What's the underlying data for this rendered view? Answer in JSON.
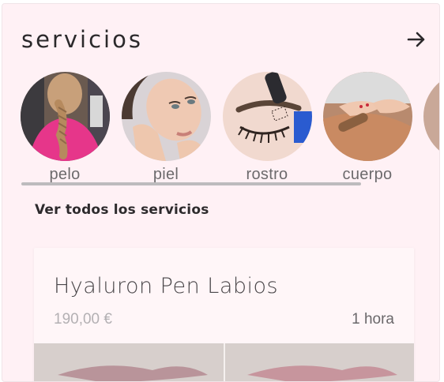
{
  "header": {
    "title": "servicios",
    "arrow_icon": "arrow-right-icon"
  },
  "services": [
    {
      "label": "pelo",
      "image": "braided-hair-photo"
    },
    {
      "label": "piel",
      "image": "skin-face-photo"
    },
    {
      "label": "rostro",
      "image": "eyebrow-treatment-photo"
    },
    {
      "label": "cuerpo",
      "image": "body-massage-photo"
    }
  ],
  "view_all": {
    "label": "Ver todos los servicios"
  },
  "card": {
    "title": "Hyaluron Pen Labios",
    "price": "190,00 €",
    "duration": "1 hora",
    "image": "lips-before-after-photo"
  },
  "colors": {
    "background": "#fff1f5",
    "text": "#2d2a2c",
    "muted": "#b3b0b3",
    "scrollbar": "#bdbbbd"
  }
}
